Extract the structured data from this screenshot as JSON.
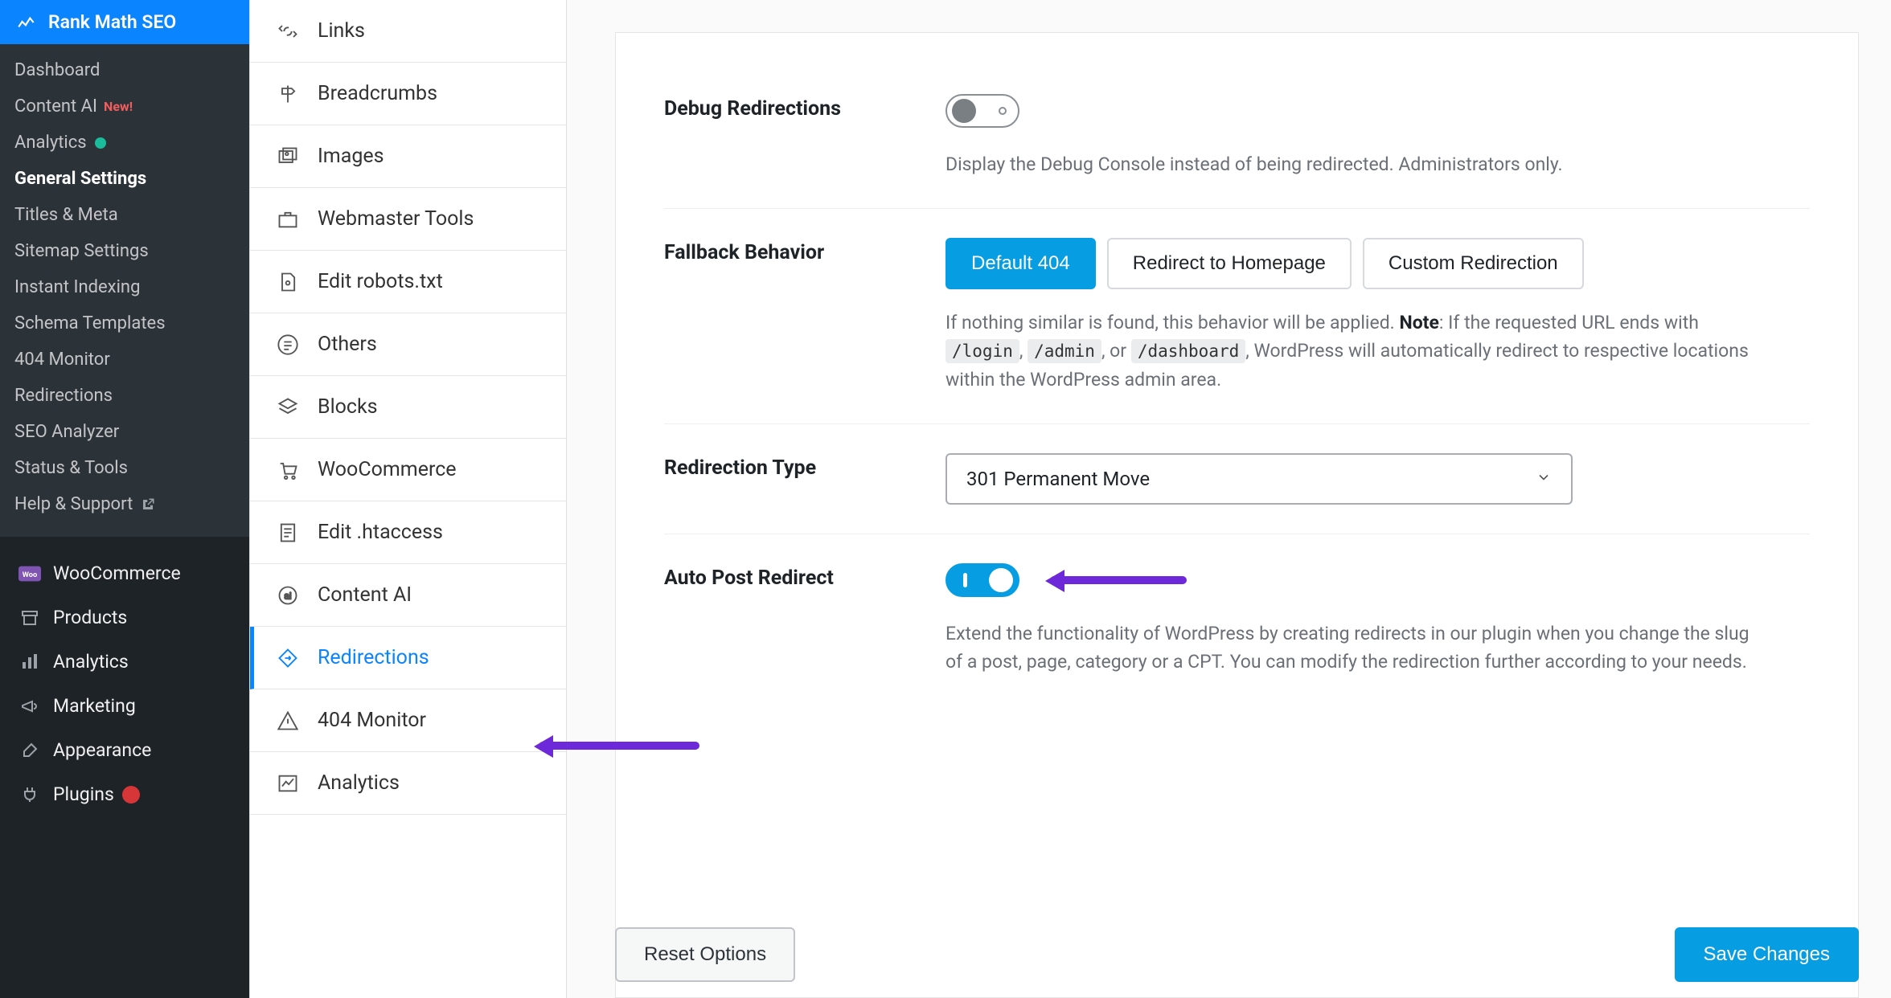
{
  "wp_sidebar": {
    "top": {
      "label": "Rank Math SEO"
    },
    "sub": [
      {
        "label": "Dashboard"
      },
      {
        "label": "Content AI",
        "new": "New!"
      },
      {
        "label": "Analytics",
        "dot": true
      },
      {
        "label": "General Settings",
        "current": true
      },
      {
        "label": "Titles & Meta"
      },
      {
        "label": "Sitemap Settings"
      },
      {
        "label": "Instant Indexing"
      },
      {
        "label": "Schema Templates"
      },
      {
        "label": "404 Monitor"
      },
      {
        "label": "Redirections"
      },
      {
        "label": "SEO Analyzer"
      },
      {
        "label": "Status & Tools"
      },
      {
        "label": "Help & Support",
        "external": true
      }
    ],
    "main": [
      {
        "label": "WooCommerce",
        "icon": "woo"
      },
      {
        "label": "Products",
        "icon": "archive"
      },
      {
        "label": "Analytics",
        "icon": "bar-chart"
      },
      {
        "label": "Marketing",
        "icon": "megaphone"
      },
      {
        "label": "Appearance",
        "icon": "brush"
      },
      {
        "label": "Plugins",
        "icon": "plug",
        "badge": "•"
      }
    ]
  },
  "rm_tabs": [
    {
      "label": "Links",
      "icon": "links"
    },
    {
      "label": "Breadcrumbs",
      "icon": "signpost"
    },
    {
      "label": "Images",
      "icon": "images"
    },
    {
      "label": "Webmaster Tools",
      "icon": "briefcase"
    },
    {
      "label": "Edit robots.txt",
      "icon": "file"
    },
    {
      "label": "Others",
      "icon": "list"
    },
    {
      "label": "Blocks",
      "icon": "blocks"
    },
    {
      "label": "WooCommerce",
      "icon": "cart"
    },
    {
      "label": "Edit .htaccess",
      "icon": "file-lines"
    },
    {
      "label": "Content AI",
      "icon": "ai"
    },
    {
      "label": "Redirections",
      "icon": "redirect",
      "active": true
    },
    {
      "label": "404 Monitor",
      "icon": "warn"
    },
    {
      "label": "Analytics",
      "icon": "graph"
    }
  ],
  "settings": {
    "debug": {
      "label": "Debug Redirections",
      "on": false,
      "desc": "Display the Debug Console instead of being redirected. Administrators only."
    },
    "fallback": {
      "label": "Fallback Behavior",
      "options": [
        "Default 404",
        "Redirect to Homepage",
        "Custom Redirection"
      ],
      "active": 0,
      "desc_pre": "If nothing similar is found, this behavior will be applied. ",
      "note_label": "Note",
      "desc_mid": ": If the requested URL ends with ",
      "code1": "/login",
      "sep1": ", ",
      "code2": "/admin",
      "sep2": ", or ",
      "code3": "/dashboard",
      "desc_post": ", WordPress will automatically redirect to respective locations within the WordPress admin area."
    },
    "redir_type": {
      "label": "Redirection Type",
      "value": "301 Permanent Move"
    },
    "auto_post": {
      "label": "Auto Post Redirect",
      "on": true,
      "desc": "Extend the functionality of WordPress by creating redirects in our plugin when you change the slug of a post, page, category or a CPT. You can modify the redirection further according to your needs."
    }
  },
  "footer": {
    "reset": "Reset Options",
    "save": "Save Changes"
  }
}
